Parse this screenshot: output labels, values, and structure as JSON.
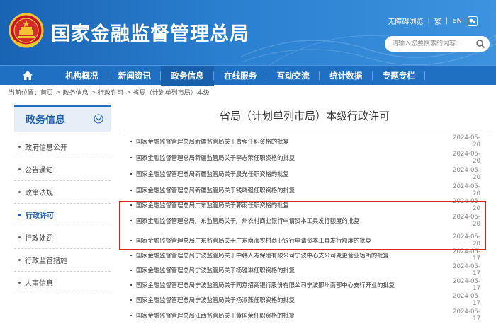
{
  "header": {
    "site_title": "国家金融监督管理总局",
    "top_links": [
      "无障碍浏览",
      "繁",
      "EN"
    ],
    "search_placeholder": "请输入您要搜索的内容..."
  },
  "nav": {
    "home_icon": "home-icon",
    "items": [
      {
        "label": "机构概况"
      },
      {
        "label": "新闻资讯"
      },
      {
        "label": "政务信息",
        "active": true
      },
      {
        "label": "在线服务"
      },
      {
        "label": "互动交流"
      },
      {
        "label": "统计数据"
      },
      {
        "label": "专题专栏"
      }
    ]
  },
  "breadcrumb": {
    "prefix": "当前位置：",
    "items": [
      "首页",
      "政务信息",
      "行政许可",
      "省局（计划单列市局）本级"
    ]
  },
  "sidebar": {
    "title": "政务信息",
    "items": [
      {
        "label": "政府信息公开"
      },
      {
        "label": "公告通知"
      },
      {
        "label": "政策法规"
      },
      {
        "label": "行政许可",
        "active": true
      },
      {
        "label": "行政处罚"
      },
      {
        "label": "行政监管措施"
      },
      {
        "label": "人事信息"
      }
    ]
  },
  "main": {
    "title": "省局（计划单列市局）本级行政许可",
    "rows": [
      {
        "title": "国家金融监督管理总局新疆监管局关于曹强任职资格的批复",
        "date": "2024-05-20"
      },
      {
        "title": "国家金融监督管理总局新疆监管局关于李志荣任职资格的批复",
        "date": "2024-05-20"
      },
      {
        "title": "国家金融监督管理总局新疆监管局关于晨光任职资格的批复",
        "date": "2024-05-20"
      },
      {
        "title": "国家金融监督管理总局新疆监管局关于钱晓强任职资格的批复",
        "date": "2024-05-20"
      },
      {
        "title": "国家金融监督管理总局广东监管局关于郭雨任职资格的批复",
        "date": "2024-05-20"
      },
      {
        "title": "国家金融监督管理总局广东监管局关于广州农村商业银行申请资本工具发行额度的批复",
        "date": "2024-05-20"
      },
      {
        "title": "国家金融监督管理总局广东监管局关于广东南海农村商业银行申请资本工具发行额度的批复",
        "date": "2024-05-20"
      },
      {
        "title": "国家金融监督管理总局宁波监管局关于中韩人寿保险有限公司宁波中心支公司变更营业场所的批复",
        "date": "2024-05-17"
      },
      {
        "title": "国家金融监督管理总局宁波监管局关于杨雅琳任职资格的批复",
        "date": "2024-05-17"
      },
      {
        "title": "国家金融监督管理总局宁波监管局关于同意招商银行股份有限公司宁波鄞州南部中心支行开业的批复",
        "date": "2024-05-17"
      },
      {
        "title": "国家金融监督管理总局宁波监管局关于杨淑燕任职资格的批复",
        "date": "2024-05-17"
      },
      {
        "title": "国家金融监督管理总局江西监管局关于黄国荣任职资格的批复",
        "date": "2024-05-17"
      }
    ]
  },
  "colors": {
    "header_blue": "#2a7fd0",
    "nav_blue": "#1f6fc2",
    "highlight_red": "#e2231a"
  }
}
